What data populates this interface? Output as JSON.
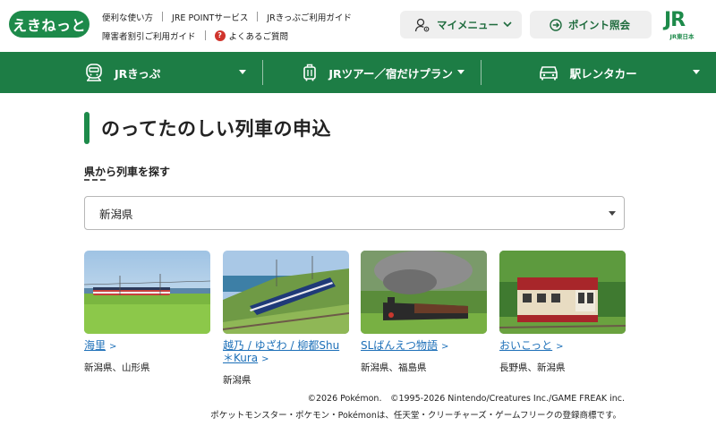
{
  "header": {
    "logo_text": "えきねっと",
    "util_links": [
      "便利な使い方",
      "JRE POINTサービス",
      "JRきっぷご利用ガイド",
      "障害者割引ご利用ガイド",
      "よくあるご質問"
    ],
    "help_badge": "?",
    "my_menu_label": "マイメニュー",
    "point_label": "ポイント照会",
    "jr_mark": "JR",
    "jr_sub": "JR東日本"
  },
  "nav": {
    "items": [
      {
        "label": "JRきっぷ",
        "icon": "train-icon"
      },
      {
        "label": "JRツアー／宿だけプラン",
        "icon": "suitcase-icon"
      },
      {
        "label": "駅レンタカー",
        "icon": "car-icon"
      }
    ]
  },
  "main": {
    "page_title": "のってたのしい列車の申込",
    "section_label": "県から列車を探す",
    "prefecture_select": {
      "selected": "新潟県"
    },
    "trains": [
      {
        "name": "海里",
        "prefectures": "新潟県、山形県"
      },
      {
        "name": "越乃 / ゆざわ / 柳都Shu＊Kura",
        "prefectures": "新潟県"
      },
      {
        "name": "SLばんえつ物語",
        "prefectures": "新潟県、福島県"
      },
      {
        "name": "おいこっと",
        "prefectures": "長野県、新潟県"
      }
    ],
    "link_arrow": ">"
  },
  "footer": {
    "copyright": "©2026 Pokémon.　©1995-2026 Nintendo/Creatures Inc./GAME FREAK inc.",
    "trademark": "ポケットモンスター・ポケモン・Pokémonは、任天堂・クリーチャーズ・ゲームフリークの登録商標です。"
  },
  "colors": {
    "brand_green": "#1d8a4a",
    "nav_green": "#1d7d45",
    "link_blue": "#1c6fb8",
    "help_red": "#d0342c"
  }
}
